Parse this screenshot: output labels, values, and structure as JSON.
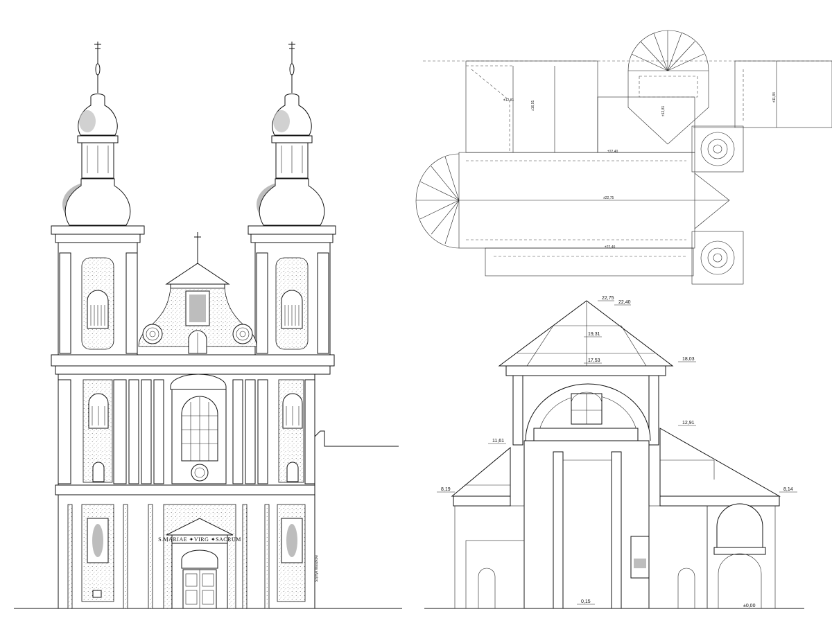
{
  "elevation": {
    "portal_inscription": "S.MARIAE ✦VIRG ✦SACRUM",
    "signature": "Szyfryk Waszkow"
  },
  "section": {
    "levels": [
      "22,75",
      "22,40",
      "19,31",
      "18,03",
      "17,53",
      "12,91",
      "11,61",
      "8,19",
      "8,14",
      "0,15",
      "±0,00"
    ]
  },
  "roof_plan": {
    "ridge_labels": [
      "±22,75",
      "±22,40",
      "±22,40"
    ],
    "slope_labels": [
      "±12,81",
      "±16,91",
      "±12,81",
      "±11,84"
    ]
  },
  "colors": {
    "line": "#111111",
    "shade": "#bdbdbd",
    "background": "#ffffff"
  }
}
